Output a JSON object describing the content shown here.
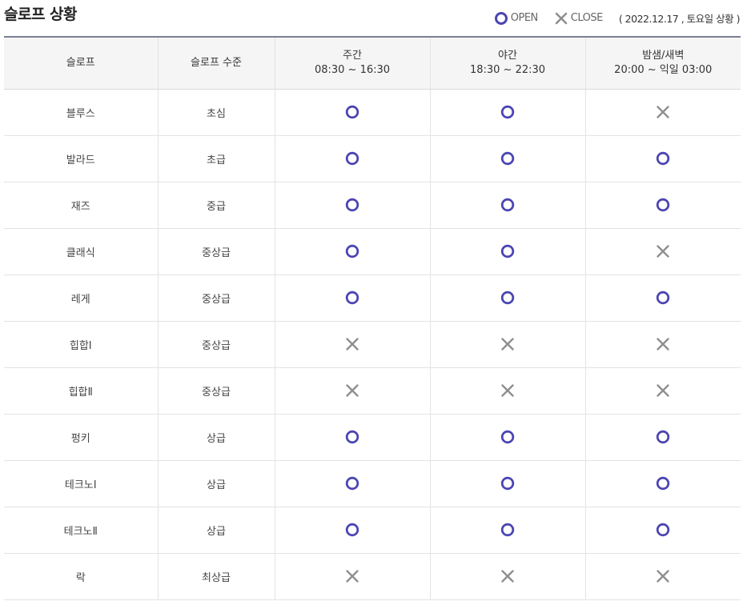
{
  "title": "슬로프 상황",
  "legend": {
    "open_label": "OPEN",
    "close_label": "CLOSE",
    "date": "( 2022.12.17 , 토요일 상황 )"
  },
  "colors": {
    "open": "#4b45b3",
    "close": "#8f8f8f"
  },
  "columns": {
    "slope": "슬로프",
    "level": "슬로프 수준",
    "day": {
      "name": "주간",
      "time": "08:30 ~ 16:30"
    },
    "night": {
      "name": "야간",
      "time": "18:30 ~ 22:30"
    },
    "late": {
      "name": "밤샘/새벽",
      "time": "20:00 ~ 익일 03:00"
    }
  },
  "rows": [
    {
      "slope": "블루스",
      "level": "초심",
      "day": "open",
      "night": "open",
      "late": "close"
    },
    {
      "slope": "발라드",
      "level": "초급",
      "day": "open",
      "night": "open",
      "late": "open"
    },
    {
      "slope": "재즈",
      "level": "중급",
      "day": "open",
      "night": "open",
      "late": "open"
    },
    {
      "slope": "클래식",
      "level": "중상급",
      "day": "open",
      "night": "open",
      "late": "close"
    },
    {
      "slope": "레게",
      "level": "중상급",
      "day": "open",
      "night": "open",
      "late": "open"
    },
    {
      "slope": "힙합Ⅰ",
      "level": "중상급",
      "day": "close",
      "night": "close",
      "late": "close"
    },
    {
      "slope": "힙합Ⅱ",
      "level": "중상급",
      "day": "close",
      "night": "close",
      "late": "close"
    },
    {
      "slope": "펑키",
      "level": "상급",
      "day": "open",
      "night": "open",
      "late": "open"
    },
    {
      "slope": "테크노Ⅰ",
      "level": "상급",
      "day": "open",
      "night": "open",
      "late": "open"
    },
    {
      "slope": "테크노Ⅱ",
      "level": "상급",
      "day": "open",
      "night": "open",
      "late": "open"
    },
    {
      "slope": "락",
      "level": "최상급",
      "day": "close",
      "night": "close",
      "late": "close"
    }
  ]
}
